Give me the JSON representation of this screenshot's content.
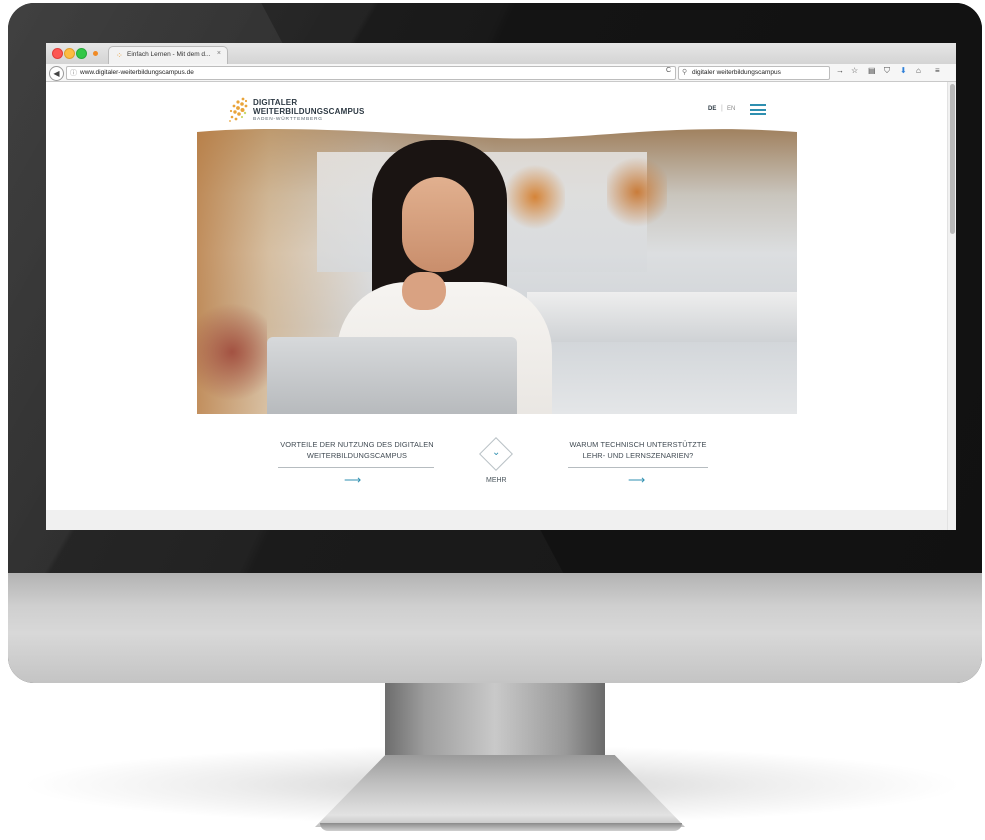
{
  "browser": {
    "tab_title": "Einfach Lernen - Mit dem d...",
    "tab_close": "×",
    "url": "www.digitaler-weiterbildungscampus.de",
    "search_query": "digitaler weiterbildungscampus"
  },
  "site": {
    "logo_line1": "DIGITALER",
    "logo_line2": "WEITERBILDUNGSCAMPUS",
    "logo_line3": "BADEN-WÜRTTEMBERG",
    "lang_de": "DE",
    "lang_sep": "|",
    "lang_en": "EN",
    "accent_color": "#2f8fb0"
  },
  "cta_left": {
    "text": "VORTEILE DER NUTZUNG DES DIGITALEN WEITERBILDUNGSCAMPUS",
    "arrow": "⟶"
  },
  "more": {
    "label": "MEHR",
    "chevron": "⌄"
  },
  "cta_right": {
    "text": "WARUM TECHNISCH UNTERSTÜTZTE LEHR- UND LERNSZENARIEN?",
    "arrow": "⟶"
  },
  "icons": {
    "back": "◀",
    "info": "ⓘ",
    "reload": "C",
    "search": "⚲",
    "go": "→",
    "bookmark_star": "☆",
    "reader": "▤",
    "pocket": "⛉",
    "download": "⬇",
    "home": "⌂",
    "menu": "≡",
    "favicon": "⁘"
  }
}
